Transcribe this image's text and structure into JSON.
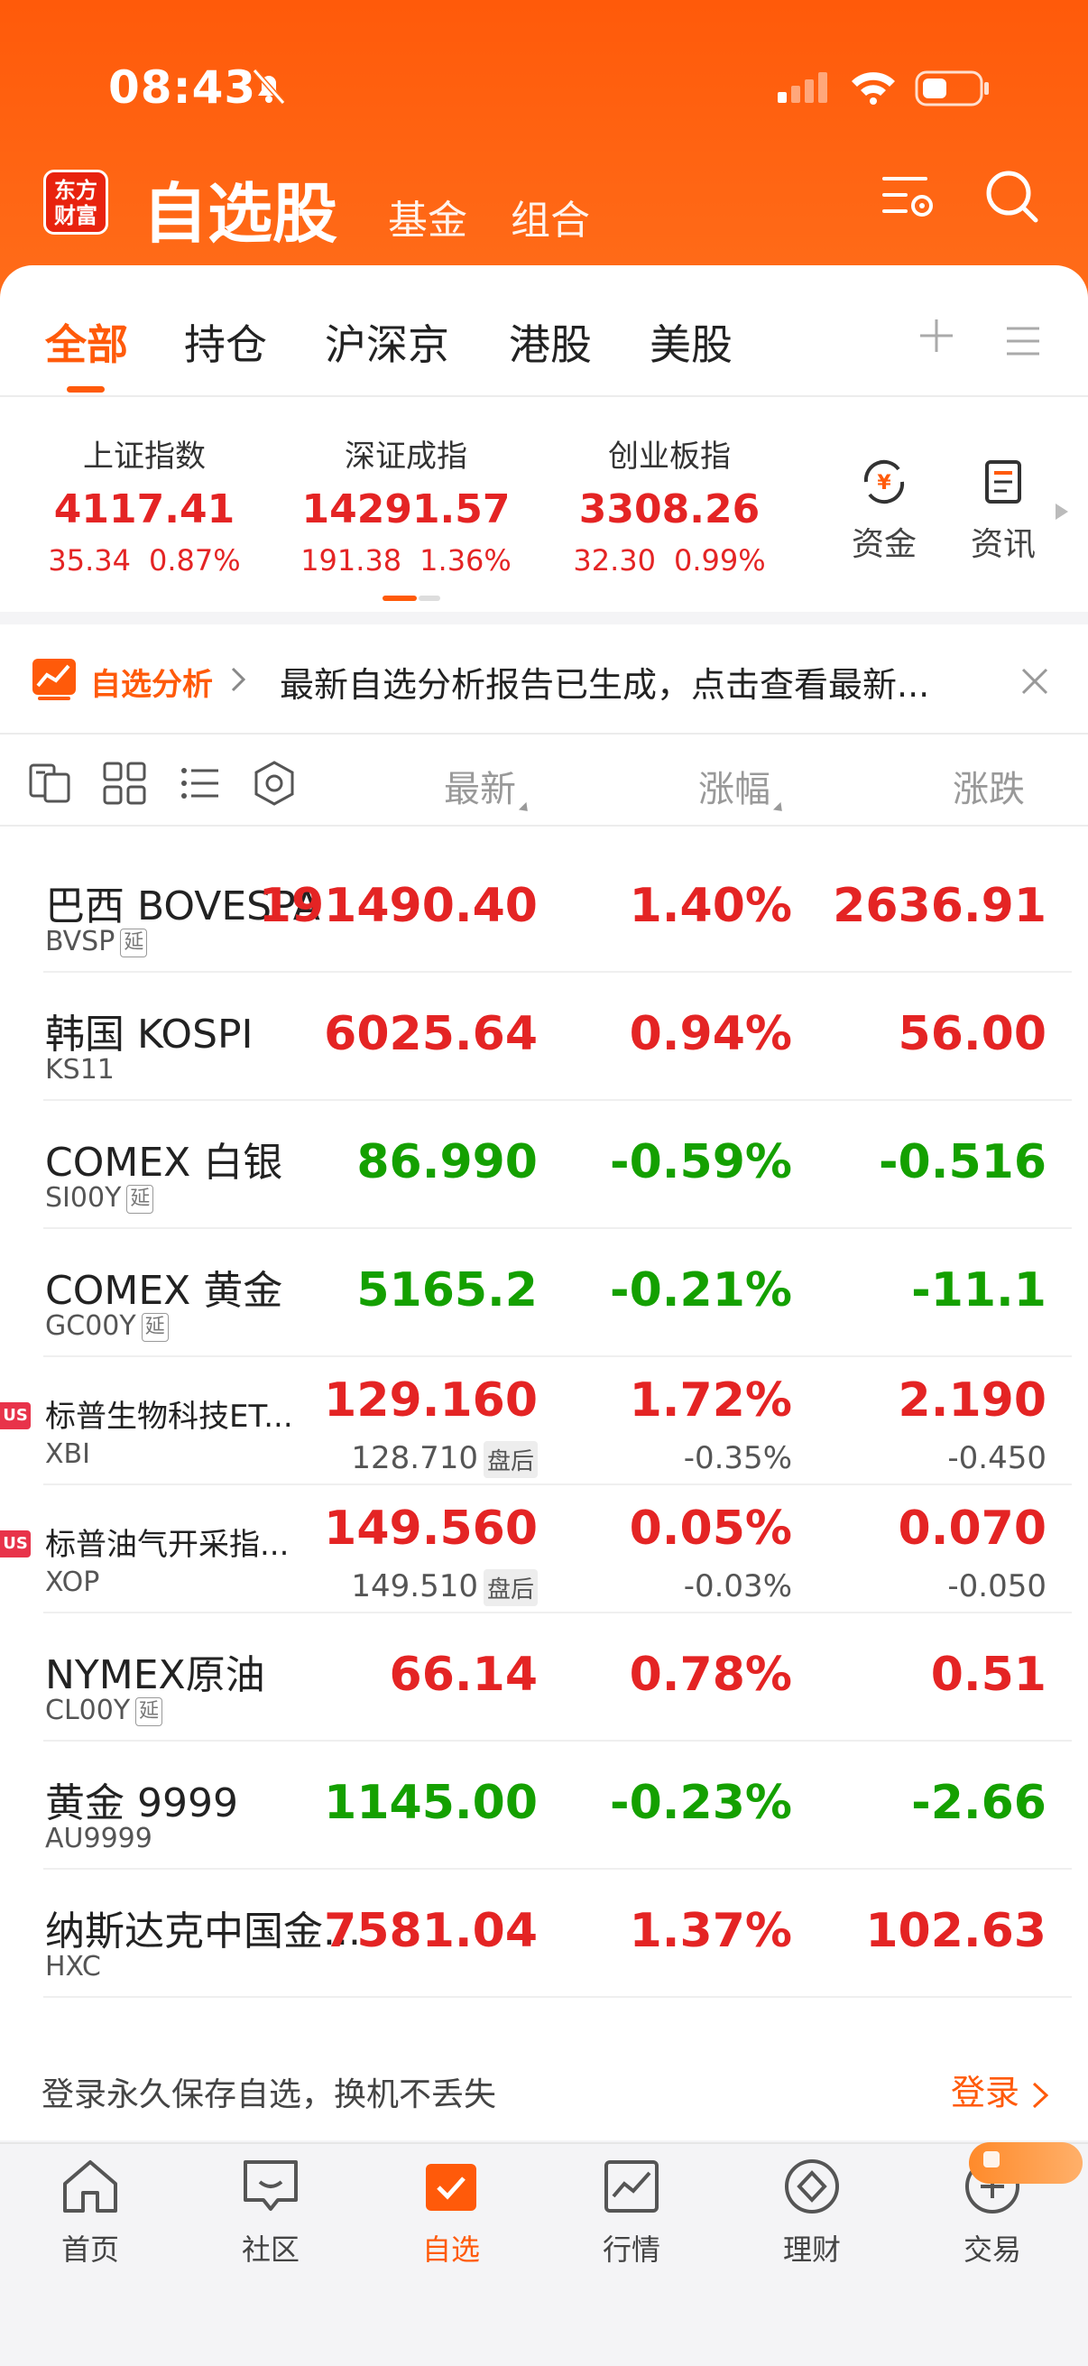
{
  "status_bar": {
    "time": "08:43"
  },
  "header": {
    "logo_line1": "东方",
    "logo_line2": "财富",
    "title": "自选股",
    "subnav": [
      "基金",
      "组合"
    ]
  },
  "tabs": [
    "全部",
    "持仓",
    "沪深京",
    "港股",
    "美股"
  ],
  "indices": [
    {
      "name": "上证指数",
      "value": "4117.41",
      "change": "35.34",
      "pct": "0.87%"
    },
    {
      "name": "深证成指",
      "value": "14291.57",
      "change": "191.38",
      "pct": "1.36%"
    },
    {
      "name": "创业板指",
      "value": "3308.26",
      "change": "32.30",
      "pct": "0.99%"
    }
  ],
  "quick_links": [
    {
      "label": "资金",
      "icon": "fund-flow-icon"
    },
    {
      "label": "资讯",
      "icon": "news-icon"
    }
  ],
  "banner": {
    "tag": "自选分析",
    "text": "最新自选分析报告已生成，点击查看最新..."
  },
  "columns": {
    "latest": "最新",
    "pct": "涨幅",
    "change": "涨跌"
  },
  "stocks": [
    {
      "name": "巴西 BOVESPA",
      "code": "BVSP",
      "delay": "延",
      "latest": "191490.40",
      "pct": "1.40%",
      "change": "2636.91",
      "dir": "up"
    },
    {
      "name": "韩国 KOSPI",
      "code": "KS11",
      "latest": "6025.64",
      "pct": "0.94%",
      "change": "56.00",
      "dir": "up"
    },
    {
      "name": "COMEX 白银",
      "code": "SI00Y",
      "delay": "延",
      "latest": "86.990",
      "pct": "-0.59%",
      "change": "-0.516",
      "dir": "dn"
    },
    {
      "name": "COMEX 黄金",
      "code": "GC00Y",
      "delay": "延",
      "latest": "5165.2",
      "pct": "-0.21%",
      "change": "-11.1",
      "dir": "dn"
    },
    {
      "name": "标普生物科技ET...",
      "code": "XBI",
      "market": "US",
      "latest": "129.160",
      "pct": "1.72%",
      "change": "2.190",
      "dir": "up",
      "after_hours": {
        "latest": "128.710",
        "tag": "盘后",
        "pct": "-0.35%",
        "change": "-0.450"
      }
    },
    {
      "name": "标普油气开采指...",
      "code": "XOP",
      "market": "US",
      "latest": "149.560",
      "pct": "0.05%",
      "change": "0.070",
      "dir": "up",
      "after_hours": {
        "latest": "149.510",
        "tag": "盘后",
        "pct": "-0.03%",
        "change": "-0.050"
      }
    },
    {
      "name": "NYMEX原油",
      "code": "CL00Y",
      "delay": "延",
      "latest": "66.14",
      "pct": "0.78%",
      "change": "0.51",
      "dir": "up"
    },
    {
      "name": "黄金 9999",
      "code": "AU9999",
      "latest": "1145.00",
      "pct": "-0.23%",
      "change": "-2.66",
      "dir": "dn"
    },
    {
      "name": "纳斯达克中国金...",
      "code": "HXC",
      "latest": "7581.04",
      "pct": "1.37%",
      "change": "102.63",
      "dir": "up"
    }
  ],
  "login_prompt": {
    "text": "登录永久保存自选，换机不丢失",
    "button": "登录"
  },
  "bottom_nav": [
    {
      "label": "首页",
      "icon": "home-icon"
    },
    {
      "label": "社区",
      "icon": "community-icon"
    },
    {
      "label": "自选",
      "icon": "watchlist-icon",
      "active": true
    },
    {
      "label": "行情",
      "icon": "market-icon"
    },
    {
      "label": "理财",
      "icon": "wealth-icon"
    },
    {
      "label": "交易",
      "icon": "trade-icon"
    }
  ],
  "colors": {
    "accent": "#ff5a0a",
    "up": "#e42424",
    "down": "#14a000"
  }
}
